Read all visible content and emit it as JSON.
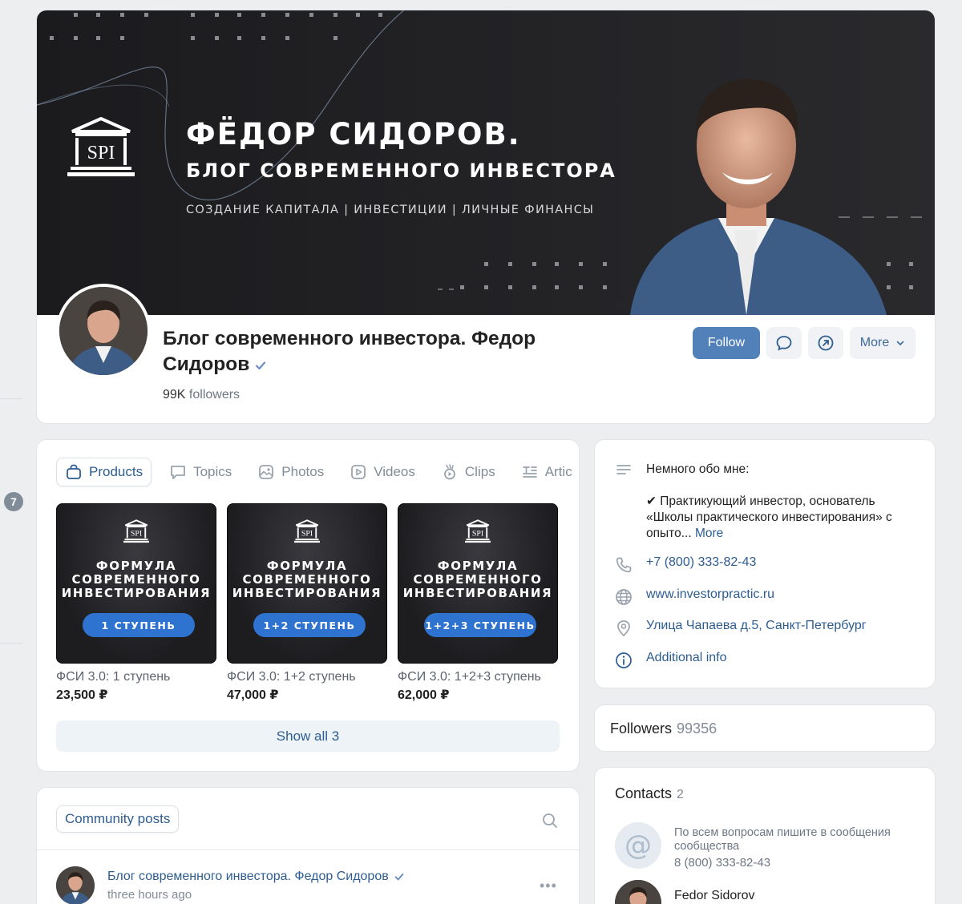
{
  "header": {
    "cover_title": "ФЁДОР СИДОРОВ.",
    "cover_subtitle": "БЛОГ СОВРЕМЕННОГО ИНВЕСТОРА",
    "cover_tags": "СОЗДАНИЕ КАПИТАЛА | ИНВЕСТИЦИИ | ЛИЧНЫЕ ФИНАНСЫ",
    "logo_text": "SPI",
    "group_name": "Блог современного инвестора. Федор Сидоров",
    "followers_count": "99K",
    "followers_label": "followers",
    "follow_label": "Follow",
    "more_label": "More"
  },
  "left_rail": {
    "badge": "7"
  },
  "products": {
    "tabs": [
      {
        "label": "Products",
        "icon": "bag-icon",
        "active": true
      },
      {
        "label": "Topics",
        "icon": "chat-icon",
        "active": false
      },
      {
        "label": "Photos",
        "icon": "photo-icon",
        "active": false
      },
      {
        "label": "Videos",
        "icon": "video-icon",
        "active": false
      },
      {
        "label": "Clips",
        "icon": "clips-icon",
        "active": false
      },
      {
        "label": "Artic",
        "icon": "articles-icon",
        "active": false
      }
    ],
    "items": [
      {
        "image_title": "ФОРМУЛА СОВРЕМЕННОГО ИНВЕСТИРОВАНИЯ",
        "badge": "1 СТУПЕНЬ",
        "name": "ФСИ 3.0: 1 ступень",
        "price": "23,500 ₽"
      },
      {
        "image_title": "ФОРМУЛА СОВРЕМЕННОГО ИНВЕСТИРОВАНИЯ",
        "badge": "1+2 СТУПЕНЬ",
        "name": "ФСИ 3.0: 1+2 ступень",
        "price": "47,000 ₽"
      },
      {
        "image_title": "ФОРМУЛА СОВРЕМЕННОГО ИНВЕСТИРОВАНИЯ",
        "badge": "1+2+3 СТУПЕНЬ",
        "name": "ФСИ 3.0: 1+2+3 ступень",
        "price": "62,000 ₽"
      }
    ],
    "show_all": "Show all 3"
  },
  "posts": {
    "tab_label": "Community posts",
    "author": "Блог современного инвестора. Федор Сидоров",
    "time": "three hours ago",
    "menu": "•••"
  },
  "info": {
    "about_title": "Немного обо мне:",
    "about_text": "✔ Практикующий инвестор, основатель «Школы практического инвестирования» с опыто...",
    "about_more": "More",
    "phone": "+7 (800) 333-82-43",
    "website": "www.investorpractic.ru",
    "address": "Улица Чапаева д.5, Санкт-Петербург",
    "additional": "Additional info"
  },
  "followers_block": {
    "label": "Followers",
    "count": "99356"
  },
  "contacts": {
    "label": "Contacts",
    "count": "2",
    "at_symbol": "@",
    "first_desc": "По всем вопросам пишите в сообщения сообщества",
    "first_phone": "8 (800) 333-82-43",
    "second_name": "Fedor Sidorov"
  },
  "colors": {
    "accent": "#5181b8",
    "link": "#2d5d91",
    "page_bg": "#edeef0",
    "badge_blue": "#2f73d1"
  }
}
